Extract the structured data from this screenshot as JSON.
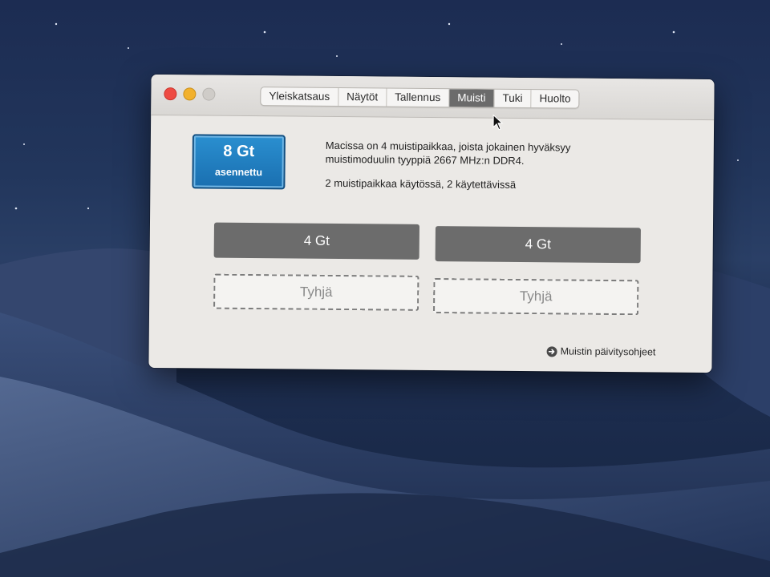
{
  "window": {
    "tabs": [
      {
        "label": "Yleiskatsaus",
        "active": false
      },
      {
        "label": "Näytöt",
        "active": false
      },
      {
        "label": "Tallennus",
        "active": false
      },
      {
        "label": "Muisti",
        "active": true
      },
      {
        "label": "Tuki",
        "active": false
      },
      {
        "label": "Huolto",
        "active": false
      }
    ]
  },
  "memory": {
    "badge_size": "8 Gt",
    "badge_label": "asennettu",
    "description": "Macissa on 4 muistipaikkaa, joista jokainen hyväksyy muistimoduulin tyyppiä 2667 MHz:n DDR4.",
    "usage": "2 muistipaikkaa käytössä, 2 käytettävissä",
    "slots": [
      {
        "label": "4 Gt",
        "state": "filled"
      },
      {
        "label": "4 Gt",
        "state": "filled"
      },
      {
        "label": "Tyhjä",
        "state": "empty"
      },
      {
        "label": "Tyhjä",
        "state": "empty"
      }
    ],
    "upgrade_link": "Muistin päivitysohjeet"
  },
  "colors": {
    "badge_blue": "#1a7cc0",
    "active_tab": "#6b6b6b",
    "slot_filled": "#6c6c6c",
    "close": "#ee4b43",
    "minimize": "#f2b12d"
  },
  "icons": {
    "link_icon": "arrow-right-circle-icon",
    "cursor": "mouse-pointer-icon"
  }
}
